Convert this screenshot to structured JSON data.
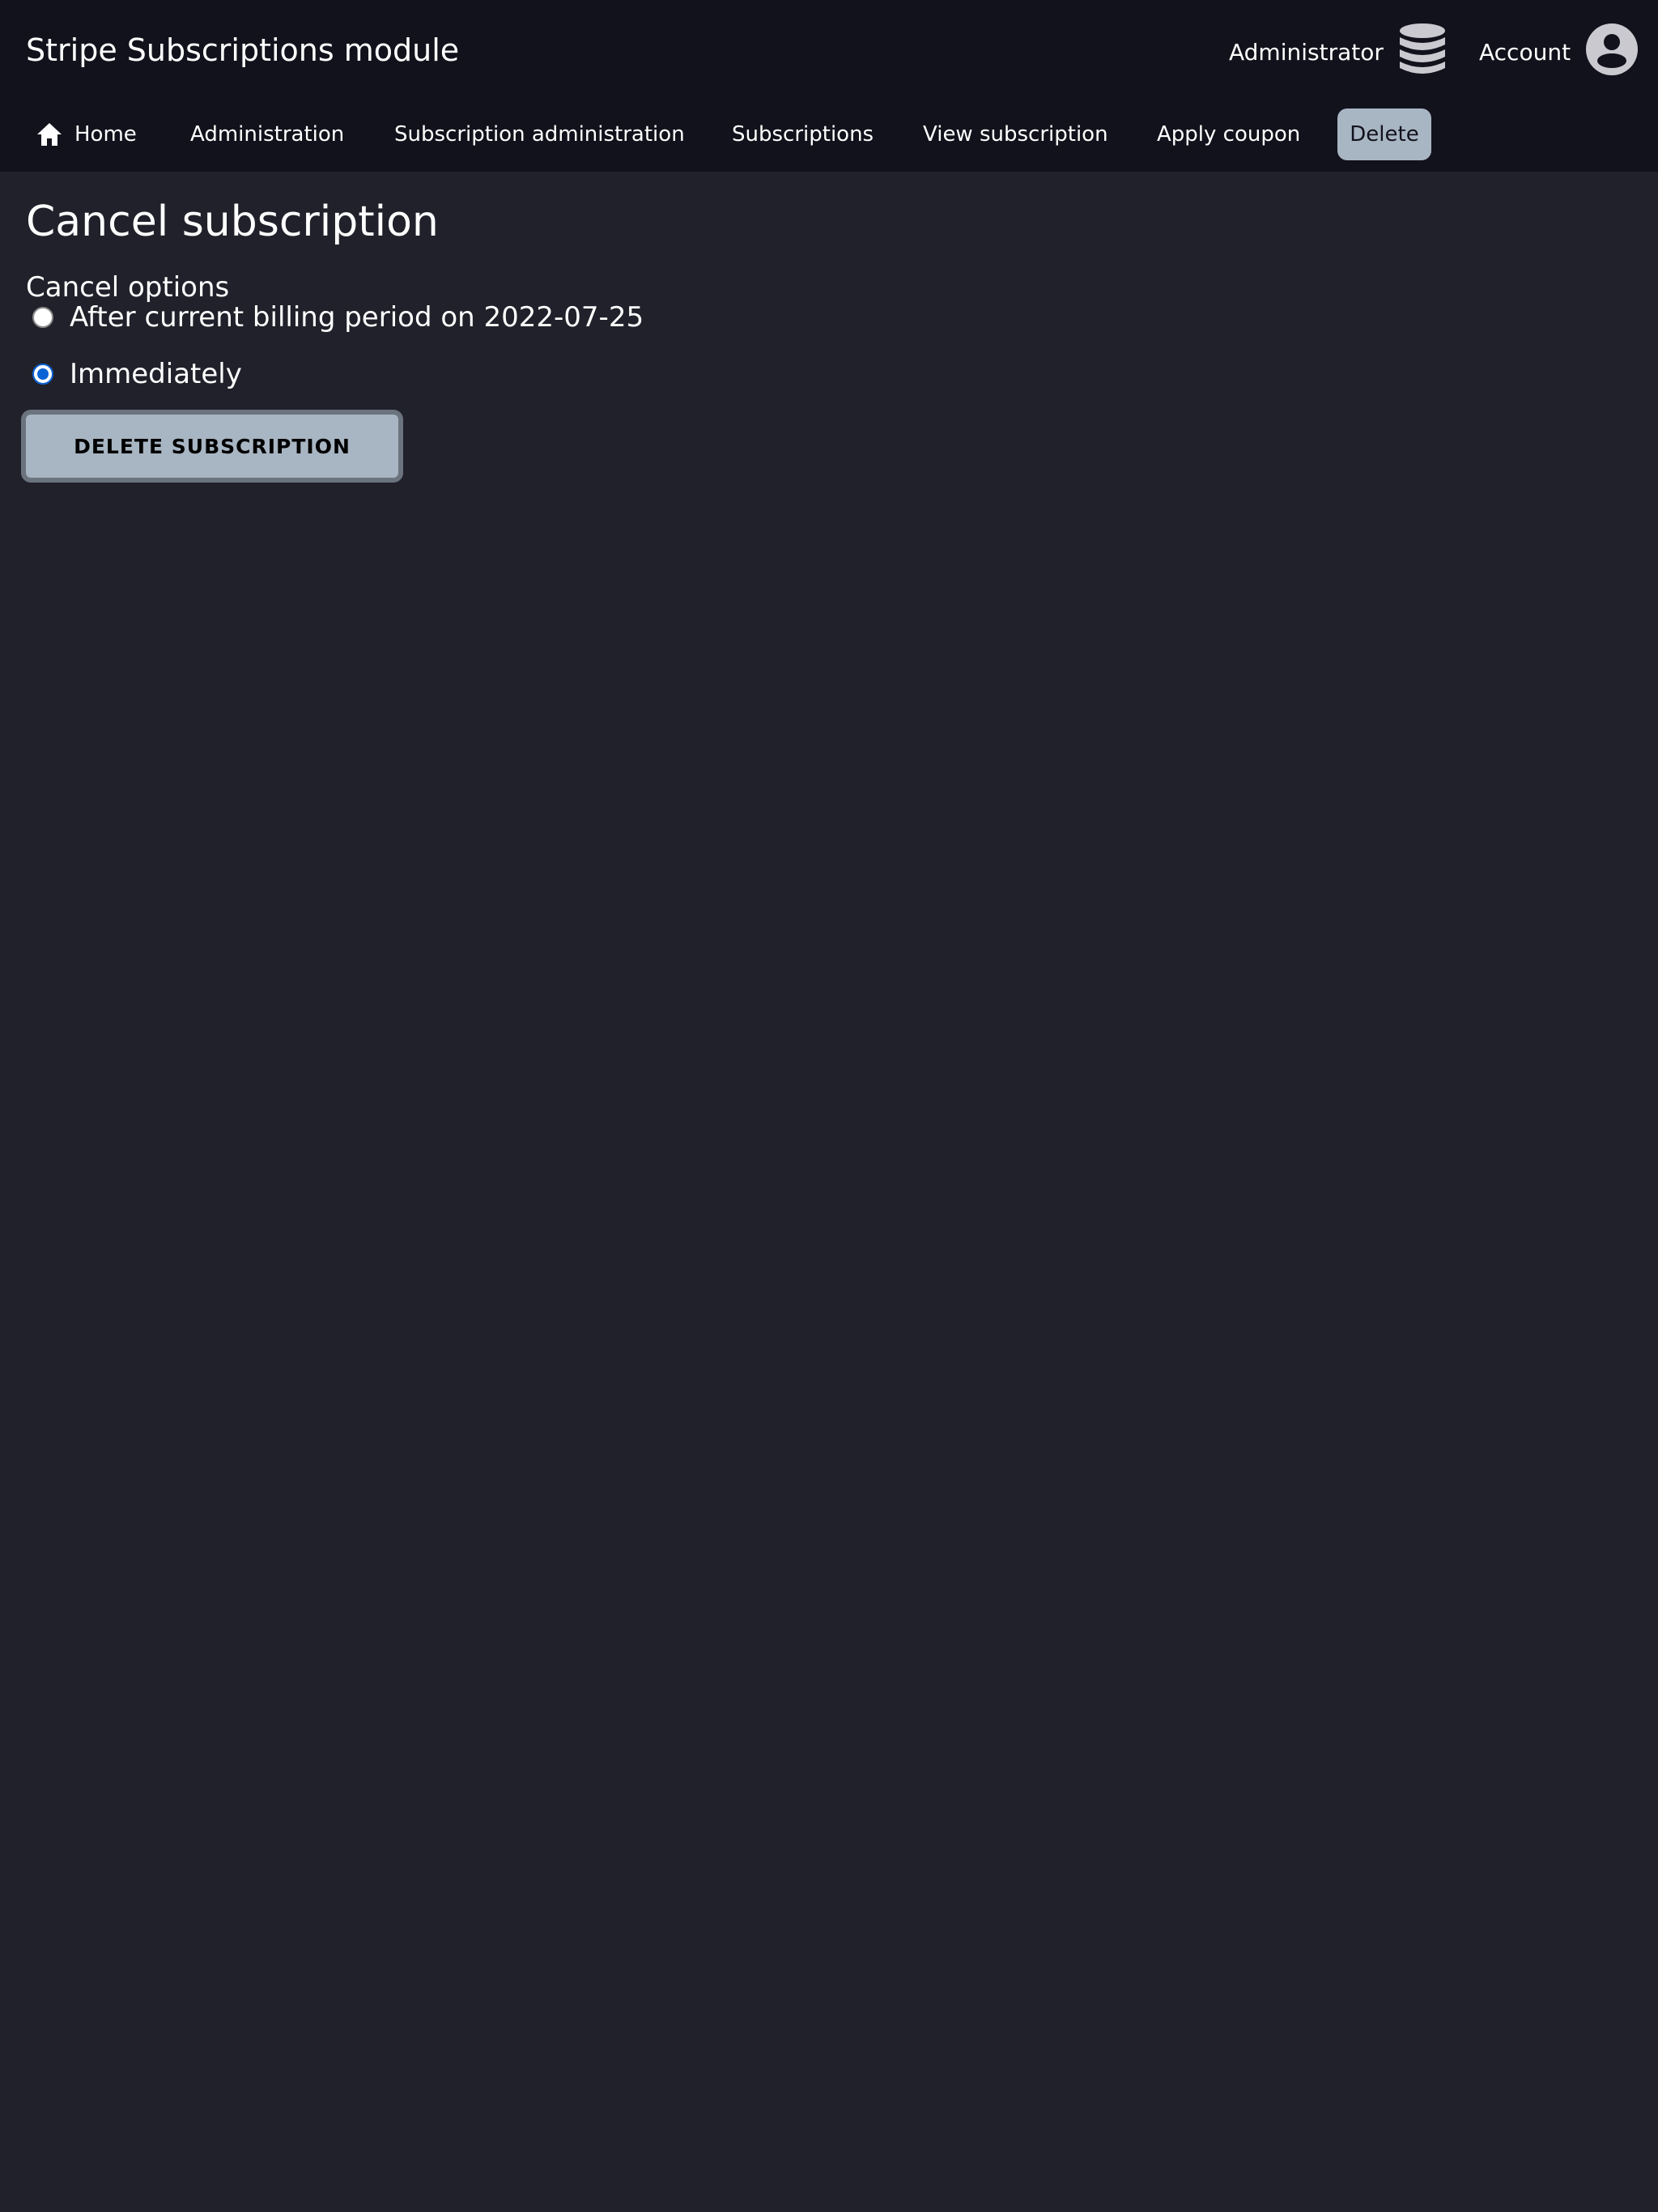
{
  "header": {
    "site_title": "Stripe Subscriptions module",
    "admin_label": "Administrator",
    "admin_icon": "database-icon",
    "account_label": "Account",
    "account_icon": "user-circle-icon"
  },
  "nav": {
    "items": [
      {
        "label": "Home",
        "icon": "home-icon"
      },
      {
        "label": "Administration"
      },
      {
        "label": "Subscription administration"
      },
      {
        "label": "Subscriptions"
      },
      {
        "label": "View subscription"
      },
      {
        "label": "Apply coupon"
      },
      {
        "label": "Delete",
        "active": true
      }
    ]
  },
  "page": {
    "title": "Cancel subscription"
  },
  "form": {
    "fieldset_label": "Cancel options",
    "options": [
      {
        "label": "After current billing period on 2022-07-25",
        "checked": false
      },
      {
        "label": "Immediately",
        "checked": true
      }
    ],
    "submit_label": "DELETE SUBSCRIPTION"
  },
  "colors": {
    "background": "#21212b",
    "header_background": "#12121c",
    "active_tab": "#a8b5c2",
    "radio_accent": "#0a64d6"
  }
}
